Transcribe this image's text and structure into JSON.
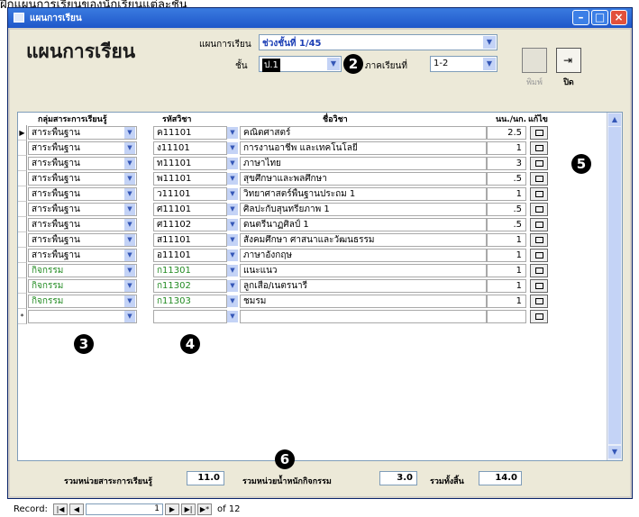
{
  "top_text": "ฝึกแผนการเรียนของนักเรียนแต่ละชั้น",
  "window": {
    "title": "แผนการเรียน"
  },
  "form": {
    "heading": "แผนการเรียน",
    "plan_label": "แผนการเรียน",
    "plan_value": "ช่วงชั้นที่ 1/45",
    "level_label": "ชั้น",
    "level_value": "ป.1",
    "semester_label": "ภาคเรียนที่",
    "semester_value": "1-2",
    "print_label": "พิมพ์",
    "close_label": "ปิด"
  },
  "columns": [
    "กลุ่มสาระการเรียนรู้",
    "รหัสวิชา",
    "ชื่อวิชา",
    "นน./นก.",
    "แก้ไข"
  ],
  "rows": [
    {
      "group": "สาระพื้นฐาน",
      "code": "ค11101",
      "name": "คณิตศาสตร์",
      "credit": "2.5",
      "kind": "basic"
    },
    {
      "group": "สาระพื้นฐาน",
      "code": "ง11101",
      "name": "การงานอาชีพ และเทคโนโลยี",
      "credit": "1",
      "kind": "basic"
    },
    {
      "group": "สาระพื้นฐาน",
      "code": "ท11101",
      "name": "ภาษาไทย",
      "credit": "3",
      "kind": "basic"
    },
    {
      "group": "สาระพื้นฐาน",
      "code": "พ11101",
      "name": "สุขศึกษาและพลศึกษา",
      "credit": ".5",
      "kind": "basic"
    },
    {
      "group": "สาระพื้นฐาน",
      "code": "ว11101",
      "name": "วิทยาศาสตร์พื้นฐานประถม 1",
      "credit": "1",
      "kind": "basic"
    },
    {
      "group": "สาระพื้นฐาน",
      "code": "ศ11101",
      "name": "ศิลปะกับสุนทรียภาพ 1",
      "credit": ".5",
      "kind": "basic"
    },
    {
      "group": "สาระพื้นฐาน",
      "code": "ศ11102",
      "name": "ดนตรีนาฏศิลป์ 1",
      "credit": ".5",
      "kind": "basic"
    },
    {
      "group": "สาระพื้นฐาน",
      "code": "ส11101",
      "name": "สังคมศึกษา ศาสนาและวัฒนธรรม",
      "credit": "1",
      "kind": "basic"
    },
    {
      "group": "สาระพื้นฐาน",
      "code": "อ11101",
      "name": "ภาษาอังกฤษ",
      "credit": "1",
      "kind": "basic"
    },
    {
      "group": "กิจกรรม",
      "code": "ก11301",
      "name": "แนะแนว",
      "credit": "1",
      "kind": "activity"
    },
    {
      "group": "กิจกรรม",
      "code": "ก11302",
      "name": "ลูกเสือ/เนตรนารี",
      "credit": "1",
      "kind": "activity"
    },
    {
      "group": "กิจกรรม",
      "code": "ก11303",
      "name": "ชมรม",
      "credit": "1",
      "kind": "activity"
    }
  ],
  "new_row_marker": "*",
  "current_row_marker": "▶",
  "callouts": {
    "n2": "2",
    "n3": "3",
    "n4": "4",
    "n5": "5",
    "n6": "6"
  },
  "totals": {
    "subject_label": "รวมหน่วยสาระการเรียนรู้",
    "subject_value": "11.0",
    "activity_label": "รวมหน่วยน้ำหนักกิจกรรม",
    "activity_value": "3.0",
    "all_label": "รวมทั้งสิ้น",
    "all_value": "14.0"
  },
  "record_nav": {
    "label": "Record:",
    "current": "1",
    "of_text": "of 12"
  },
  "colors": {
    "activity_text": "#228b22",
    "title_bar": "#1f57c9",
    "callout": "#000000"
  }
}
